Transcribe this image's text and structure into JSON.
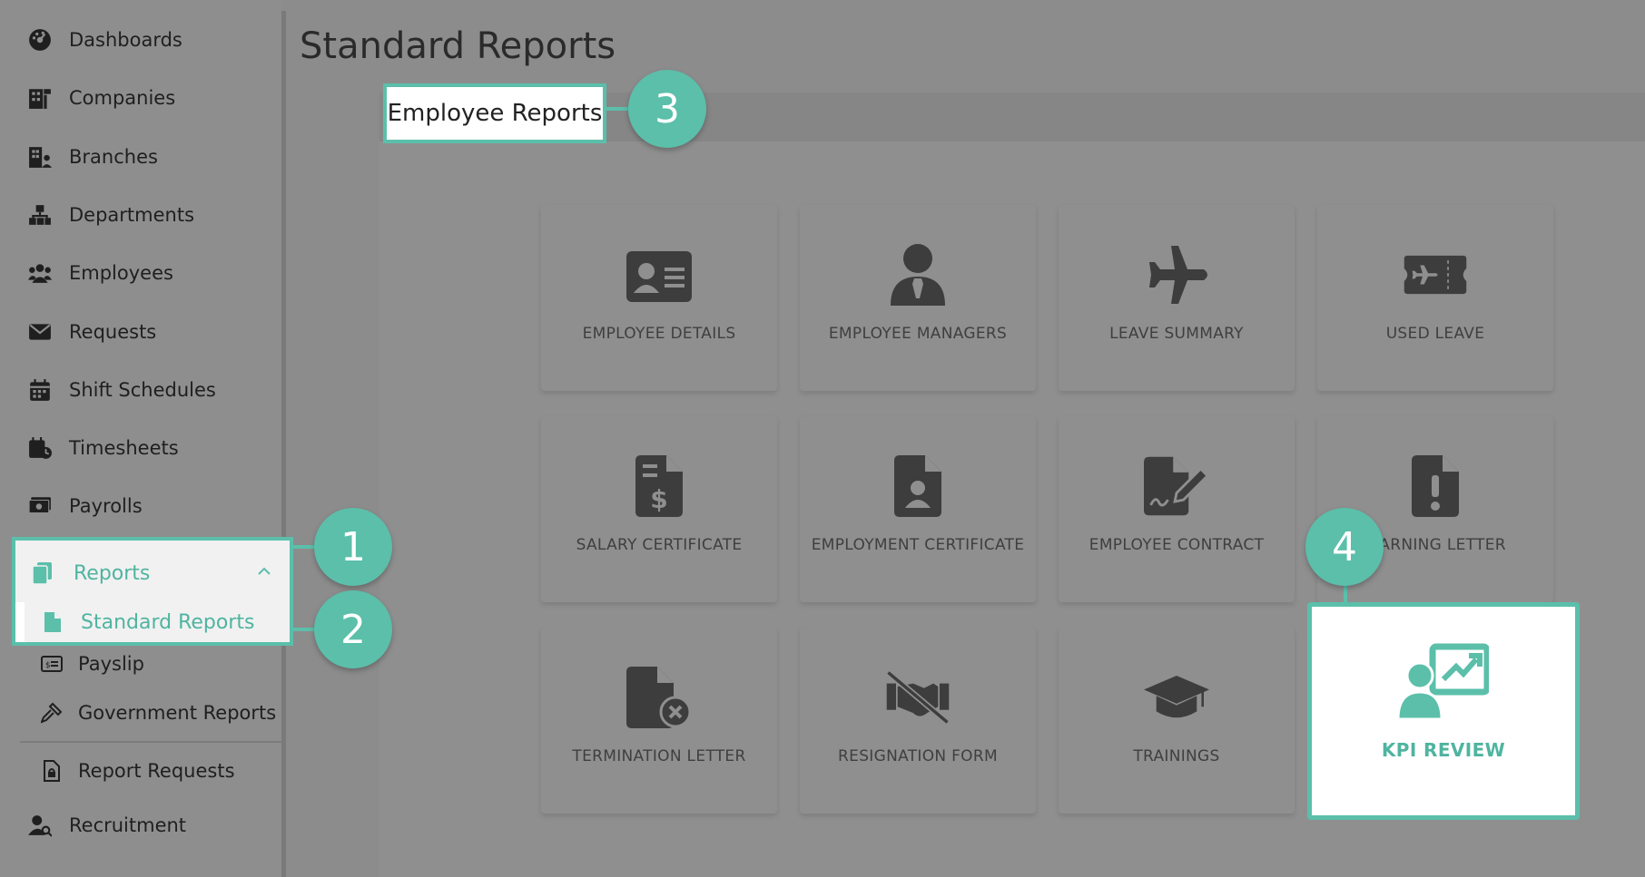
{
  "sidebar": {
    "items": [
      {
        "label": "Dashboards",
        "icon": "dashboard-icon"
      },
      {
        "label": "Companies",
        "icon": "companies-icon"
      },
      {
        "label": "Branches",
        "icon": "branches-icon"
      },
      {
        "label": "Departments",
        "icon": "departments-icon"
      },
      {
        "label": "Employees",
        "icon": "employees-icon"
      },
      {
        "label": "Requests",
        "icon": "envelope-icon"
      },
      {
        "label": "Shift Schedules",
        "icon": "calendar-icon"
      },
      {
        "label": "Timesheets",
        "icon": "calendar-clock-icon"
      },
      {
        "label": "Payrolls",
        "icon": "money-icon"
      }
    ],
    "reports": {
      "label": "Reports",
      "icon": "reports-icon"
    },
    "standard_reports": {
      "label": "Standard Reports",
      "icon": "file-icon"
    },
    "sub_items": [
      {
        "label": "Payslip",
        "icon": "payslip-icon"
      },
      {
        "label": "Government Reports",
        "icon": "gavel-icon"
      }
    ],
    "bottom_items": [
      {
        "label": "Report Requests",
        "icon": "file-lock-icon"
      },
      {
        "label": "Recruitment",
        "icon": "user-search-icon"
      }
    ]
  },
  "main": {
    "title": "Standard Reports",
    "section_label": "Employee Reports",
    "tiles": [
      {
        "label": "EMPLOYEE DETAILS",
        "icon": "id-card-icon"
      },
      {
        "label": "EMPLOYEE MANAGERS",
        "icon": "manager-icon"
      },
      {
        "label": "LEAVE SUMMARY",
        "icon": "airplane-icon"
      },
      {
        "label": "USED LEAVE",
        "icon": "ticket-icon"
      },
      {
        "label": "SALARY CERTIFICATE",
        "icon": "file-dollar-icon"
      },
      {
        "label": "EMPLOYMENT CERTIFICATE",
        "icon": "file-user-icon"
      },
      {
        "label": "EMPLOYEE CONTRACT",
        "icon": "file-signature-icon"
      },
      {
        "label": "WARNING LETTER",
        "icon": "file-exclamation-icon"
      },
      {
        "label": "TERMINATION LETTER",
        "icon": "file-x-icon"
      },
      {
        "label": "RESIGNATION FORM",
        "icon": "handshake-slash-icon"
      },
      {
        "label": "TRAININGS",
        "icon": "graduation-cap-icon"
      }
    ],
    "kpi": {
      "label": "KPI REVIEW",
      "icon": "presentation-chart-icon"
    }
  },
  "callouts": [
    "1",
    "2",
    "3",
    "4"
  ],
  "colors": {
    "accent": "#5bbfaa",
    "overlay": "#8c8c8c"
  }
}
